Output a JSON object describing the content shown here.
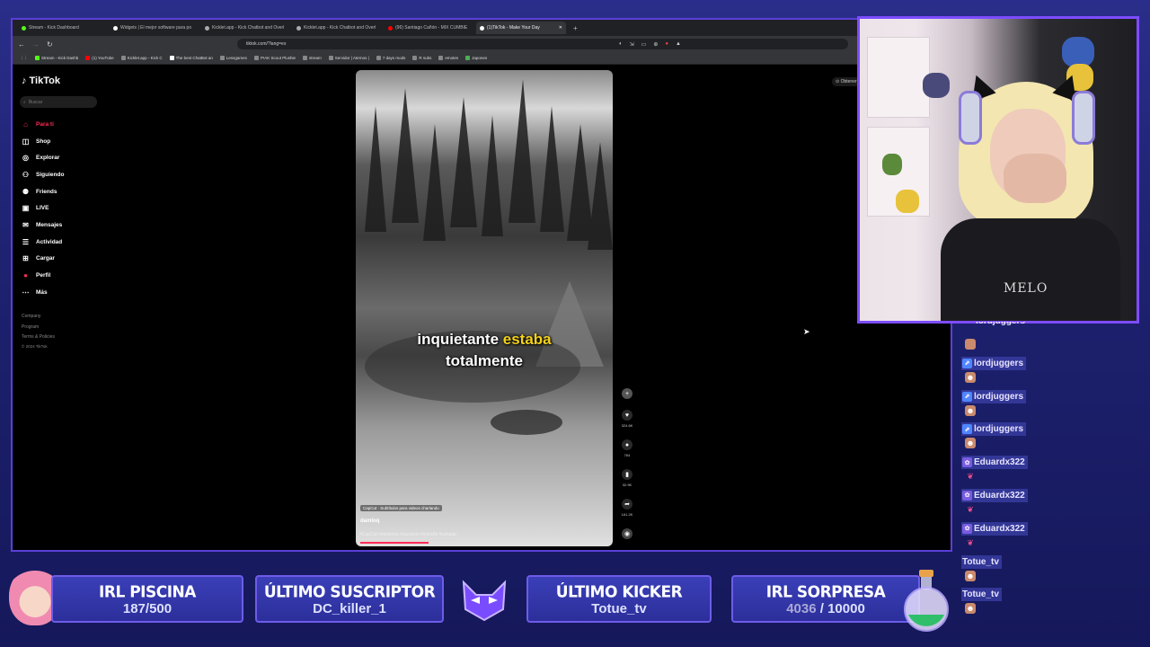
{
  "browser": {
    "tabs": [
      {
        "label": "Stream - Kick Dashboard",
        "color": "#53fc18"
      },
      {
        "label": "Widgets | El mejor software para po",
        "color": "#ffffff"
      },
      {
        "label": "Kicklet.app - Kick Chatbot and Overl",
        "color": "#aaaaaa"
      },
      {
        "label": "Kicklet.app - Kick Chatbot and Overl",
        "color": "#aaaaaa"
      },
      {
        "label": "(96) Santiago Cañón - MIX CUMBIE",
        "color": "#ff0000"
      },
      {
        "label": "(1)TikTok - Make Your Day",
        "color": "#ffffff",
        "active": true
      }
    ],
    "url": "tiktok.com/?lang=es",
    "bookmarks": [
      "Stream - Kick Dashb",
      "(1) YouTube",
      "Kicklet.app - Kick C",
      "The best ChatBot an",
      "Lessgames",
      "P!AK Scout Plushie",
      "stream",
      "Servidor | Aternos |",
      "7 days mods",
      "R subs",
      "emotes",
      "Japones"
    ]
  },
  "tiktok": {
    "logo": "TikTok",
    "search_placeholder": "Buscar",
    "nav": [
      {
        "label": "Para ti",
        "icon": "home-icon",
        "active": true
      },
      {
        "label": "Shop",
        "icon": "shop-icon"
      },
      {
        "label": "Explorar",
        "icon": "compass-icon"
      },
      {
        "label": "Siguiendo",
        "icon": "following-icon"
      },
      {
        "label": "Friends",
        "icon": "friends-icon"
      },
      {
        "label": "LIVE",
        "icon": "live-icon"
      },
      {
        "label": "Mensajes",
        "icon": "message-icon"
      },
      {
        "label": "Actividad",
        "icon": "activity-icon"
      },
      {
        "label": "Cargar",
        "icon": "upload-icon"
      },
      {
        "label": "Perfil",
        "icon": "profile-icon"
      },
      {
        "label": "Más",
        "icon": "more-icon"
      }
    ],
    "footer": [
      "Company",
      "Program",
      "Terms & Policies"
    ],
    "copyright": "© 2024 TikTok",
    "obtain_label": "Obtener",
    "video": {
      "caption_line1_a": "inquietante ",
      "caption_line1_b": "estaba",
      "caption_line2": "totalmente",
      "capcut": "CapCut · Subtítulos para videos charlando",
      "username": "damloq",
      "tags": "#CapCut #misterios #sucesos #extraño #canada"
    },
    "actions": [
      {
        "icon": "heart-icon",
        "count": "324.6K"
      },
      {
        "icon": "comment-icon",
        "count": "764"
      },
      {
        "icon": "bookmark-icon",
        "count": "32.9K"
      },
      {
        "icon": "share-icon",
        "count": "161.2K"
      }
    ]
  },
  "webcam": {
    "shirt_text": "MELO"
  },
  "chat": [
    {
      "name": "lordjuggers",
      "badge": "kick"
    },
    {
      "name": "lordjuggers",
      "badge": "kick"
    },
    {
      "name": "lordjuggers",
      "badge": "kick"
    },
    {
      "name": "Eduardx322",
      "badge": "sub"
    },
    {
      "name": "Eduardx322",
      "badge": "sub"
    },
    {
      "name": "Eduardx322",
      "badge": "sub"
    },
    {
      "name": "Totue_tv",
      "badge": ""
    },
    {
      "name": "Totue_tv",
      "badge": ""
    }
  ],
  "chat_partial_top": "lordjuggers",
  "overlay": {
    "piscina": {
      "title": "IRL PISCINA",
      "current": "187",
      "goal": "/500"
    },
    "suscriptor": {
      "title": "ÚLTIMO SUSCRIPTOR",
      "value": "DC_killer_1"
    },
    "kicker": {
      "title": "ÚLTIMO KICKER",
      "value": "Totue_tv"
    },
    "sorpresa": {
      "title": "IRL SORPRESA",
      "current": "4036",
      "goal": " / 10000"
    }
  }
}
